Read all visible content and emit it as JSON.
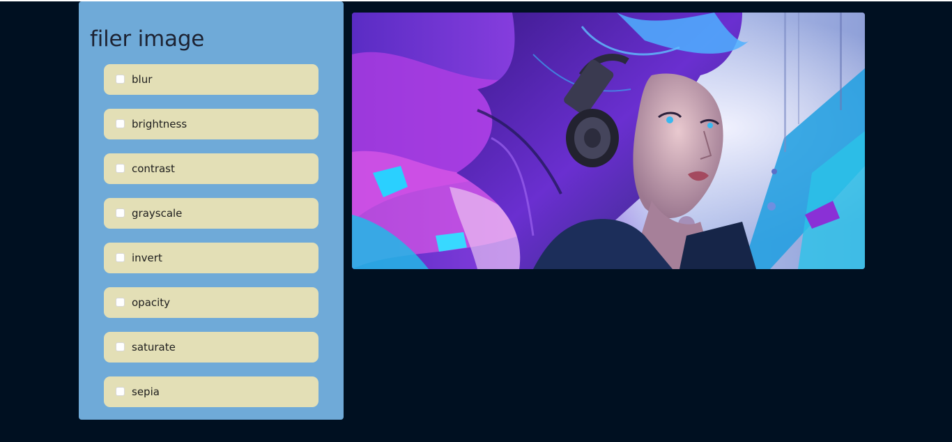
{
  "panel": {
    "title": "filer image",
    "filters": [
      {
        "label": "blur",
        "checked": false
      },
      {
        "label": "brightness",
        "checked": false
      },
      {
        "label": "contrast",
        "checked": false
      },
      {
        "label": "grayscale",
        "checked": false
      },
      {
        "label": "invert",
        "checked": false
      },
      {
        "label": "opacity",
        "checked": false
      },
      {
        "label": "saturate",
        "checked": false
      },
      {
        "label": "sepia",
        "checked": false
      }
    ]
  },
  "image": {
    "subject": "digital painting of a woman with blue-purple hair wearing headphones"
  },
  "colors": {
    "page_background": "#001021",
    "panel_background": "#6faad8",
    "item_background": "#e3dfb6",
    "title_text": "#1d2333"
  }
}
